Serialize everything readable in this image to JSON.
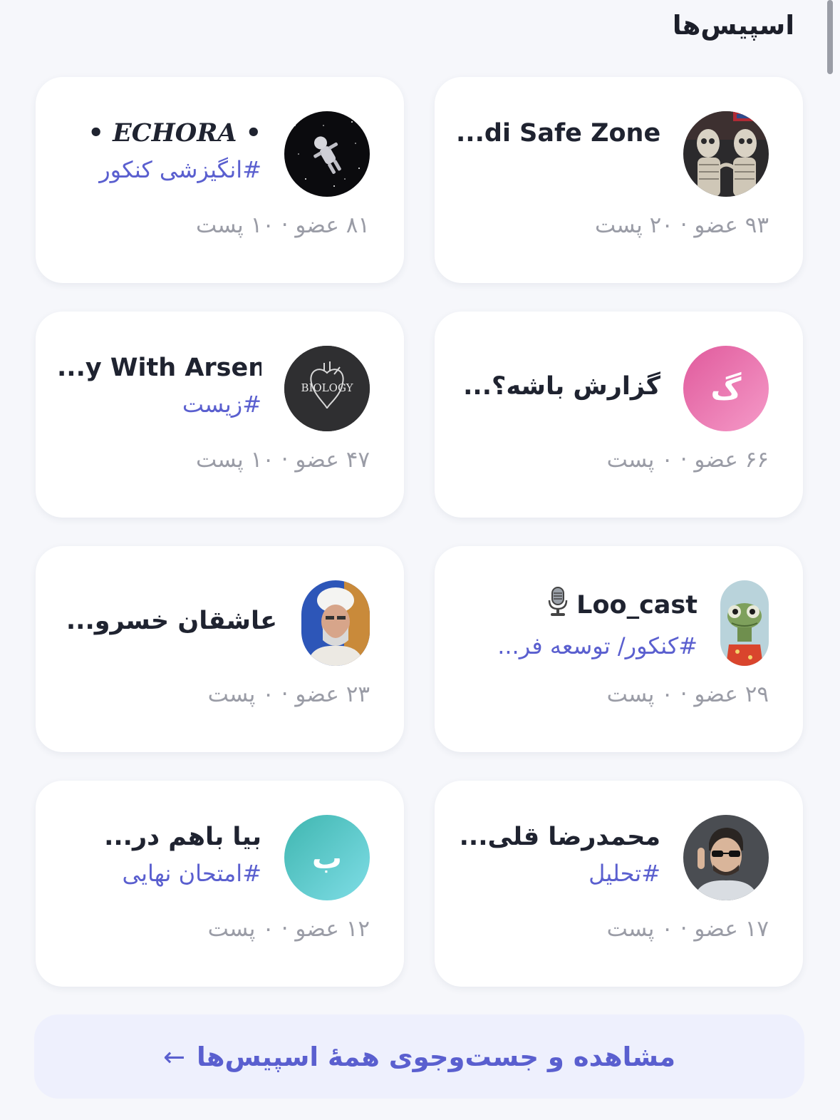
{
  "section": {
    "title": "اسپیس‌ها"
  },
  "spaces": [
    {
      "name": "...di Safe Zone",
      "tag": "",
      "stats": "۹۳ عضو · ۲۰ پست",
      "avatar": "skeletons-image"
    },
    {
      "name": "• ECHORA •",
      "tag": "#انگیزشی کنکور",
      "stats": "۸۱ عضو · ۱۰ پست",
      "avatar": "astronaut-space-image"
    },
    {
      "name": "گزارش باشه؟...",
      "tag": "",
      "stats": "۶۶ عضو · ۰ پست",
      "avatar_letter": "گ",
      "avatar_colors": [
        "#e05a9c",
        "#f59ac8"
      ]
    },
    {
      "name": "...y With Arsen",
      "tag": "#زیست",
      "stats": "۴۷ عضو · ۱۰ پست",
      "avatar": "biology-heart-image",
      "avatar_text": "BIOLOGY"
    },
    {
      "name": "Loo_cast",
      "tag": "#کنکور/ توسعه فر...",
      "stats": "۲۹ عضو · ۰ پست",
      "avatar": "chameleon-image",
      "name_icon": "microphone-icon"
    },
    {
      "name": "عاشقان خسرو...",
      "tag": "",
      "stats": "۲۳ عضو · ۰ پست",
      "avatar": "cleric-portrait-image"
    },
    {
      "name": "محمدرضا قلی...",
      "tag": "#تحلیل",
      "stats": "۱۷ عضو · ۰ پست",
      "avatar": "man-portrait-image"
    },
    {
      "name": "بیا باهم در...",
      "tag": "#امتحان نهایی",
      "stats": "۱۲ عضو · ۰ پست",
      "avatar_letter": "ب",
      "avatar_colors": [
        "#3fb6b0",
        "#7fdde6"
      ]
    }
  ],
  "footer": {
    "all_spaces_label": "مشاهده و جست‌وجوی همهٔ اسپیس‌ها",
    "arrow": "←"
  }
}
